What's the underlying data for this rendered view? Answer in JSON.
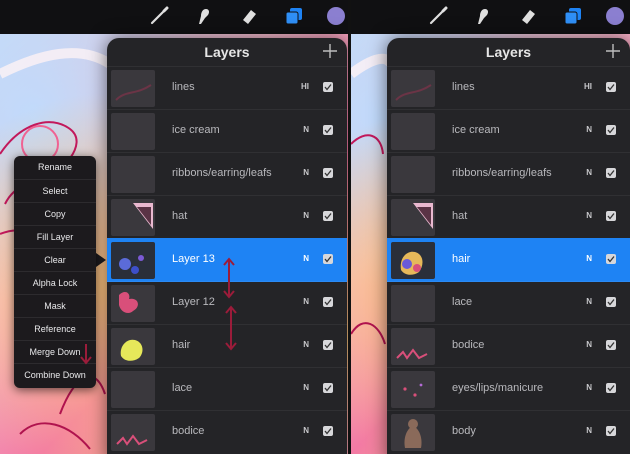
{
  "colors": {
    "accent_blue": "#1e83f4",
    "panel_bg": "#242427",
    "arrow_red": "#9b1c3a"
  },
  "icons": {
    "brush": "brush-icon",
    "smudge": "smudge-icon",
    "eraser": "eraser-icon",
    "layers": "layers-icon",
    "color": "color-swatch-icon",
    "add": "plus-icon"
  },
  "left": {
    "panel_title": "Layers",
    "layers": [
      {
        "name": "lines",
        "blend": "HI",
        "visible": true
      },
      {
        "name": "ice cream",
        "blend": "N",
        "visible": true
      },
      {
        "name": "ribbons/earring/leafs",
        "blend": "N",
        "visible": true
      },
      {
        "name": "hat",
        "blend": "N",
        "visible": true
      },
      {
        "name": "Layer 13",
        "blend": "N",
        "visible": true,
        "selected": true
      },
      {
        "name": "Layer 12",
        "blend": "N",
        "visible": true
      },
      {
        "name": "hair",
        "blend": "N",
        "visible": true
      },
      {
        "name": "lace",
        "blend": "N",
        "visible": true
      },
      {
        "name": "bodice",
        "blend": "N",
        "visible": true
      }
    ],
    "context_menu": [
      "Rename",
      "Select",
      "Copy",
      "Fill Layer",
      "Clear",
      "Alpha Lock",
      "Mask",
      "Reference",
      "Merge Down",
      "Combine Down"
    ]
  },
  "right": {
    "panel_title": "Layers",
    "layers": [
      {
        "name": "lines",
        "blend": "HI",
        "visible": true
      },
      {
        "name": "ice cream",
        "blend": "N",
        "visible": true
      },
      {
        "name": "ribbons/earring/leafs",
        "blend": "N",
        "visible": true
      },
      {
        "name": "hat",
        "blend": "N",
        "visible": true
      },
      {
        "name": "hair",
        "blend": "N",
        "visible": true,
        "selected": true
      },
      {
        "name": "lace",
        "blend": "N",
        "visible": true
      },
      {
        "name": "bodice",
        "blend": "N",
        "visible": true
      },
      {
        "name": "eyes/lips/manicure",
        "blend": "N",
        "visible": true
      },
      {
        "name": "body",
        "blend": "N",
        "visible": true
      }
    ]
  }
}
